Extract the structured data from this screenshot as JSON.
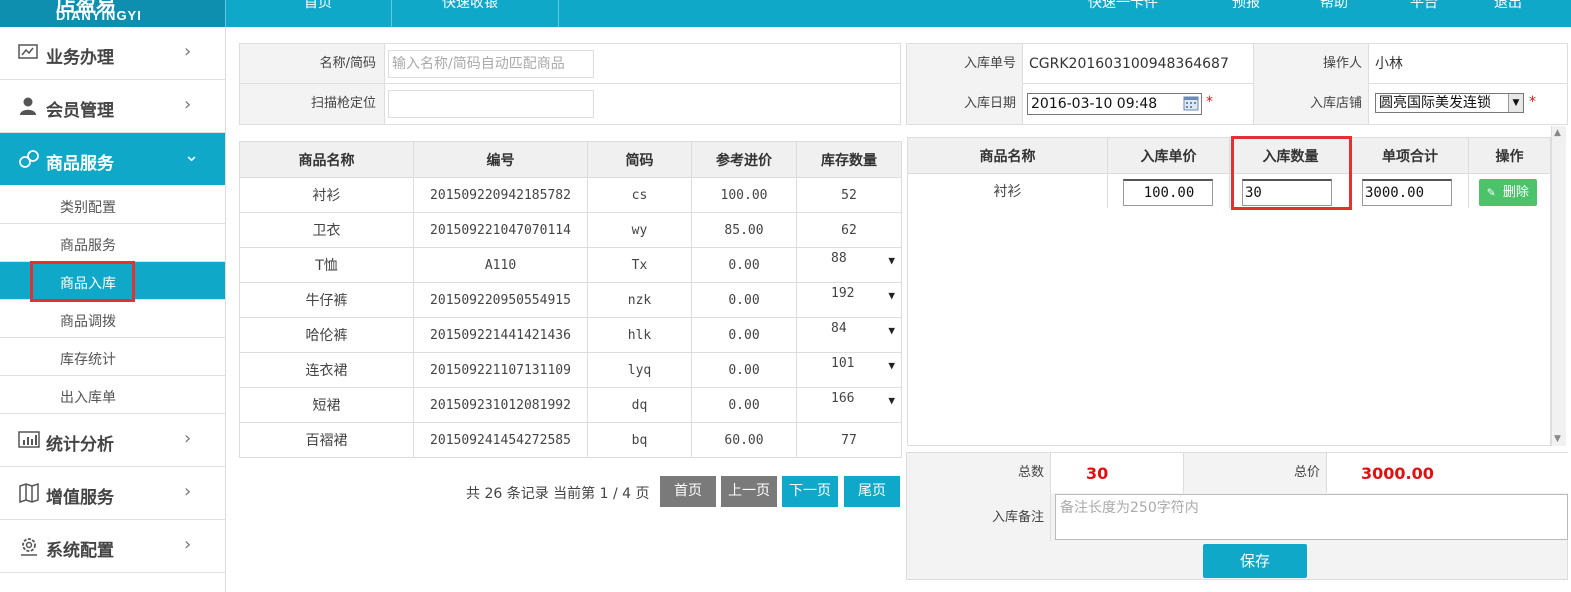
{
  "header": {
    "logo_cn": "店盈易",
    "logo_en": "DIANYINGYI",
    "nav": [
      "首页",
      "快速收银"
    ],
    "right_items": [
      "快速一卡件",
      "预报",
      "帮助",
      "平台",
      "退出"
    ]
  },
  "sidebar": {
    "groups": [
      {
        "label": "业务办理",
        "icon": "business-icon"
      },
      {
        "label": "会员管理",
        "icon": "member-icon"
      },
      {
        "label": "商品服务",
        "icon": "goods-icon"
      },
      {
        "label": "统计分析",
        "icon": "stats-icon"
      },
      {
        "label": "增值服务",
        "icon": "value-added-icon"
      },
      {
        "label": "系统配置",
        "icon": "settings-icon"
      }
    ],
    "sub_items": [
      "类别配置",
      "商品服务",
      "商品入库",
      "商品调拨",
      "库存统计",
      "出入库单"
    ]
  },
  "search": {
    "name_label": "名称/简码",
    "name_placeholder": "输入名称/简码自动匹配商品",
    "scan_label": "扫描枪定位",
    "scan_value": ""
  },
  "goods_table": {
    "headers": [
      "商品名称",
      "编号",
      "简码",
      "参考进价",
      "库存数量"
    ],
    "rows": [
      {
        "name": "衬衫",
        "code": "201509220942185782",
        "abbr": "cs",
        "price": "100.00",
        "stock": "52",
        "caret": false
      },
      {
        "name": "卫衣",
        "code": "201509221047070114",
        "abbr": "wy",
        "price": "85.00",
        "stock": "62",
        "caret": false
      },
      {
        "name": "T恤",
        "code": "A110",
        "abbr": "Tx",
        "price": "0.00",
        "stock": "88",
        "caret": true
      },
      {
        "name": "牛仔裤",
        "code": "201509220950554915",
        "abbr": "nzk",
        "price": "0.00",
        "stock": "192",
        "caret": true
      },
      {
        "name": "哈伦裤",
        "code": "201509221441421436",
        "abbr": "hlk",
        "price": "0.00",
        "stock": "84",
        "caret": true
      },
      {
        "name": "连衣裙",
        "code": "201509221107131109",
        "abbr": "lyq",
        "price": "0.00",
        "stock": "101",
        "caret": true
      },
      {
        "name": "短裙",
        "code": "201509231012081992",
        "abbr": "dq",
        "price": "0.00",
        "stock": "166",
        "caret": true
      },
      {
        "name": "百褶裙",
        "code": "201509241454272585",
        "abbr": "bq",
        "price": "60.00",
        "stock": "77",
        "caret": false
      }
    ]
  },
  "pager": {
    "info": "共 26 条记录 当前第 1 / 4 页",
    "first": "首页",
    "prev": "上一页",
    "next": "下一页",
    "last": "尾页"
  },
  "stock_in": {
    "order_no_label": "入库单号",
    "order_no": "CGRK20160310094836468​7",
    "operator_label": "操作人",
    "operator": "小林",
    "date_label": "入库日期",
    "date": "2016-03-10 09:48",
    "store_label": "入库店铺",
    "store": "圆亮国际美发连锁",
    "required_mark": "*"
  },
  "detail_table": {
    "headers": [
      "商品名称",
      "入库单价",
      "入库数量",
      "单项合计",
      "操作"
    ],
    "rows": [
      {
        "name": "衬衫",
        "unit_price": "100.00",
        "qty": "30",
        "subtotal": "3000.00",
        "action": "删除"
      }
    ]
  },
  "summary": {
    "total_qty_label": "总数",
    "total_qty": "30",
    "total_price_label": "总价",
    "total_price": "3000.00",
    "memo_label": "入库备注",
    "memo_placeholder": "备注长度为250字符内",
    "save": "保存"
  },
  "colors": {
    "primary": "#10a8c9",
    "danger": "#e01010",
    "highlight_box": "#e23131",
    "delete_btn": "#4cc26b"
  }
}
